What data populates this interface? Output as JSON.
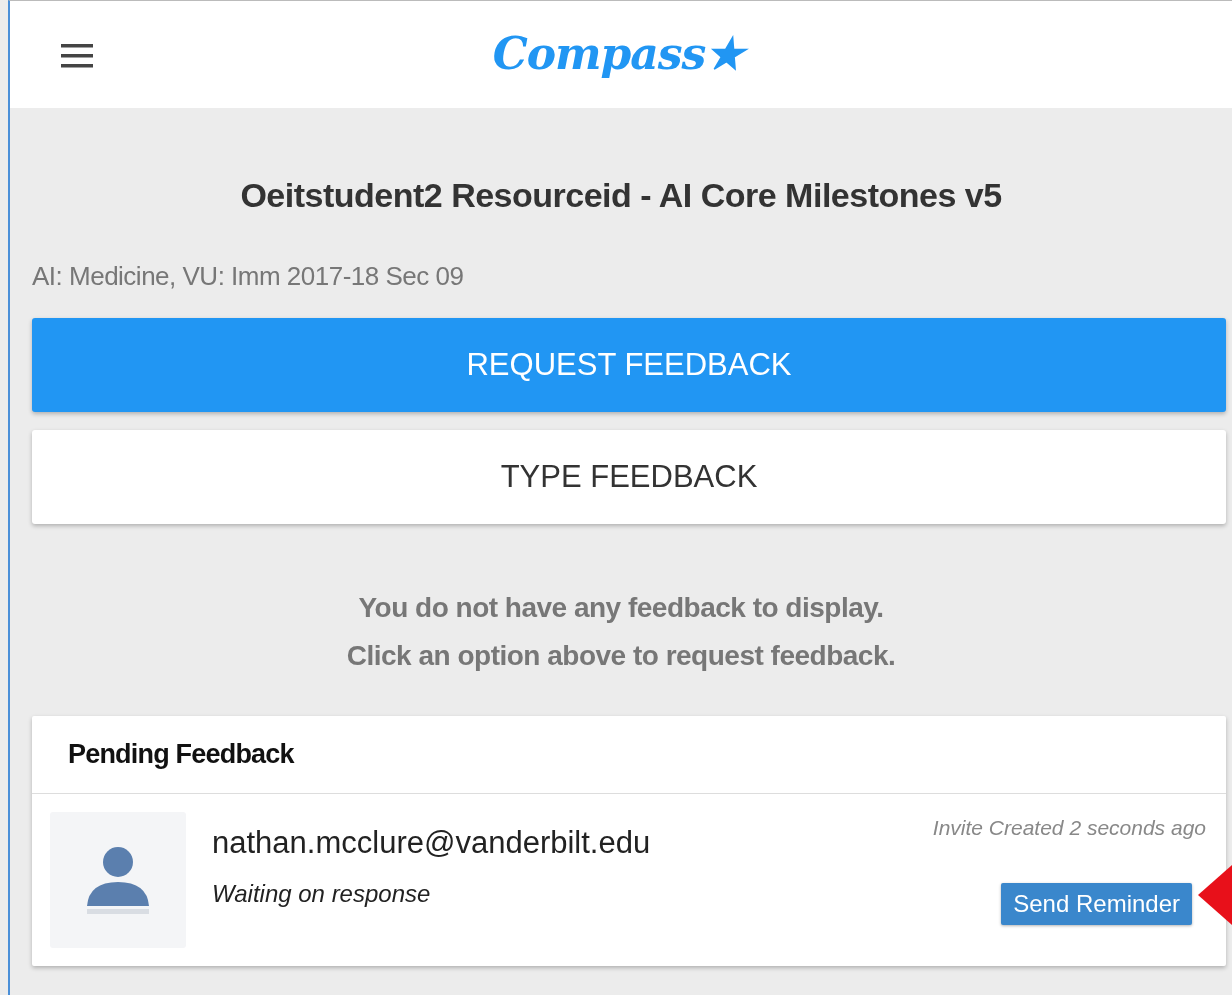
{
  "header": {
    "logo": "Compass★"
  },
  "title": "Oeitstudent2 Resourceid - AI Core Milestones v5",
  "subtitle": "AI: Medicine, VU: Imm 2017-18 Sec 09",
  "buttons": [
    {
      "label": "REQUEST FEEDBACK",
      "kind": "primary"
    },
    {
      "label": "TYPE FEEDBACK",
      "kind": "plain"
    }
  ],
  "empty_message": [
    "You do not have any feedback to display.",
    "Click an option above to request feedback."
  ],
  "pending": {
    "title": "Pending Feedback",
    "items": [
      {
        "email": "nathan.mcclure@vanderbilt.edu",
        "status": "Waiting on response",
        "created": "Invite Created 2 seconds ago",
        "action": "Send Reminder"
      }
    ]
  }
}
